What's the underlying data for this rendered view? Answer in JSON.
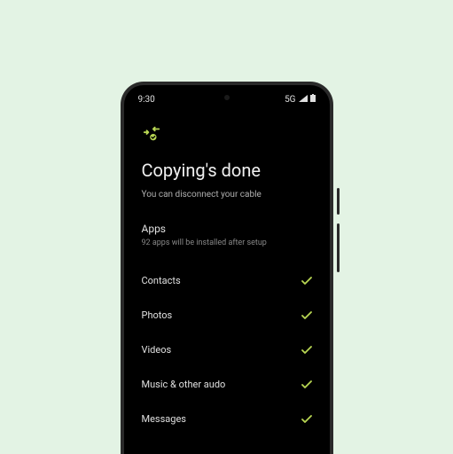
{
  "status_bar": {
    "time": "9:30",
    "network": "5G"
  },
  "header": {
    "title": "Copying's done",
    "subtitle": "You can disconnect your cable"
  },
  "apps_section": {
    "title": "Apps",
    "subtitle": "92 apps will be installed after setup"
  },
  "items": [
    {
      "label": "Contacts"
    },
    {
      "label": "Photos"
    },
    {
      "label": "Videos"
    },
    {
      "label": "Music & other audo"
    },
    {
      "label": "Messages"
    }
  ]
}
